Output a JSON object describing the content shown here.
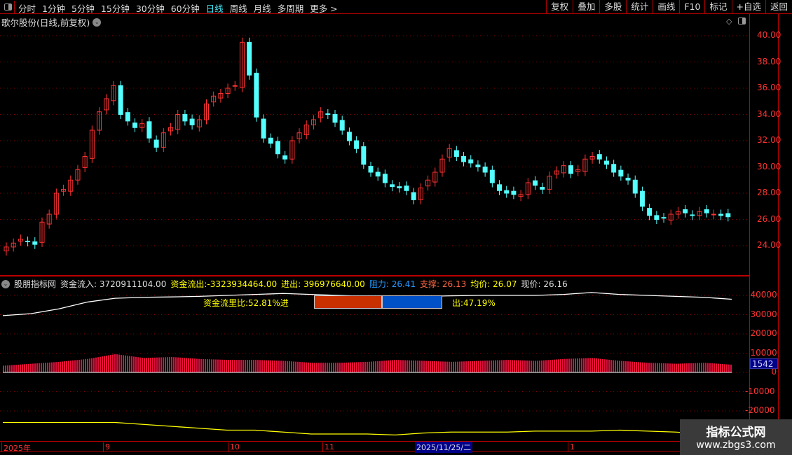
{
  "toolbar": {
    "periods": [
      "分时",
      "1分钟",
      "5分钟",
      "15分钟",
      "30分钟",
      "60分钟",
      "日线",
      "周线",
      "月线",
      "多周期",
      "更多 >"
    ],
    "active": "日线",
    "right_buttons": [
      "复权",
      "叠加",
      "多股",
      "统计",
      "画线",
      "F10",
      "标记",
      "+自选",
      "返回"
    ]
  },
  "stock_title": "歌尔股份(日线,前复权)",
  "price_axis": [
    "40.00",
    "38.00",
    "36.00",
    "34.00",
    "32.00",
    "30.00",
    "28.00",
    "26.00",
    "24.00"
  ],
  "indicator": {
    "name": "股朋指标网",
    "inflow_label": "资金流入:",
    "inflow": "3720911104.00",
    "outflow_label": "资金流出:",
    "outflow": "-3323934464.00",
    "net_label": "进出:",
    "net": "396976640.00",
    "resist_label": "阻力:",
    "resist": "26.41",
    "support_label": "支撑:",
    "support": "26.13",
    "avg_label": "均价:",
    "avg": "26.07",
    "price_label": "现价:",
    "price": "26.16",
    "ratio_in": "资金流里比:52.81%进",
    "ratio_out": "出:47.19%",
    "in_pct": 52.81,
    "current_value": "1542",
    "axis": [
      "40000",
      "30000",
      "20000",
      "10000",
      "0",
      "-10000",
      "-20000"
    ]
  },
  "date_axis": {
    "labels": [
      "2025年",
      "9",
      "10",
      "11",
      "1"
    ],
    "cursor": "2025/11/25/二"
  },
  "watermark": {
    "line1": "指标公式网",
    "line2": "www.zbgs3.com"
  },
  "colors": {
    "up": "#ff3232",
    "down": "#54ffff",
    "white_line": "#ffffff",
    "yellow_line": "#ffff00"
  },
  "chart_data": {
    "type": "candlestick",
    "price_range": [
      23,
      41
    ],
    "closes": [
      23.9,
      24.2,
      24.5,
      24.3,
      24.1,
      25.8,
      26.4,
      28.0,
      28.3,
      29.0,
      29.8,
      30.8,
      32.8,
      34.2,
      35.2,
      36.2,
      34.0,
      33.5,
      33.0,
      33.3,
      32.2,
      31.5,
      32.6,
      33.0,
      34.0,
      33.5,
      33.2,
      33.6,
      34.8,
      35.4,
      35.6,
      36.0,
      36.2,
      39.5,
      37.0,
      33.8,
      32.2,
      31.8,
      31.0,
      30.6,
      32.0,
      32.6,
      33.2,
      33.6,
      34.2,
      34.0,
      33.4,
      32.8,
      32.0,
      31.4,
      30.2,
      29.6,
      29.3,
      28.8,
      28.5,
      28.4,
      28.2,
      27.5,
      28.4,
      29.0,
      29.6,
      30.6,
      31.4,
      30.8,
      30.4,
      30.3,
      30.0,
      29.6,
      28.8,
      28.2,
      28.0,
      27.9,
      27.9,
      28.8,
      28.6,
      28.3,
      29.3,
      29.7,
      30.1,
      29.5,
      29.8,
      30.6,
      30.8,
      30.6,
      30.2,
      29.6,
      29.3,
      29.0,
      28.0,
      27.0,
      26.3,
      26.0,
      26.1,
      26.4,
      26.6,
      26.5,
      26.3,
      26.6,
      26.5,
      26.4,
      26.3,
      26.2
    ],
    "indicator_range": [
      -30000,
      45000
    ],
    "white_line": [
      29500,
      30500,
      33000,
      36500,
      38500,
      39000,
      39200,
      39500,
      40000,
      40500,
      41000,
      40500,
      40000,
      39500,
      39500,
      39500,
      39800,
      40000,
      40000,
      40000,
      40500,
      41500,
      40500,
      40000,
      39500,
      39000,
      38000
    ],
    "histogram": [
      3500,
      4500,
      5500,
      7000,
      9500,
      7500,
      8000,
      7000,
      6500,
      6500,
      6000,
      5000,
      5000,
      5500,
      6500,
      6000,
      5500,
      6000,
      6500,
      6000,
      7000,
      7500,
      6000,
      5000,
      4500,
      5000,
      4000
    ],
    "yellow_line": [
      -26000,
      -26000,
      -26000,
      -26000,
      -26000,
      -27000,
      -28000,
      -29000,
      -30000,
      -30000,
      -31000,
      -32000,
      -32000,
      -32000,
      -32500,
      -31500,
      -31000,
      -31000,
      -31000,
      -30500,
      -30500,
      -30500,
      -30000,
      -30500,
      -31000,
      -32000,
      -32000
    ]
  }
}
